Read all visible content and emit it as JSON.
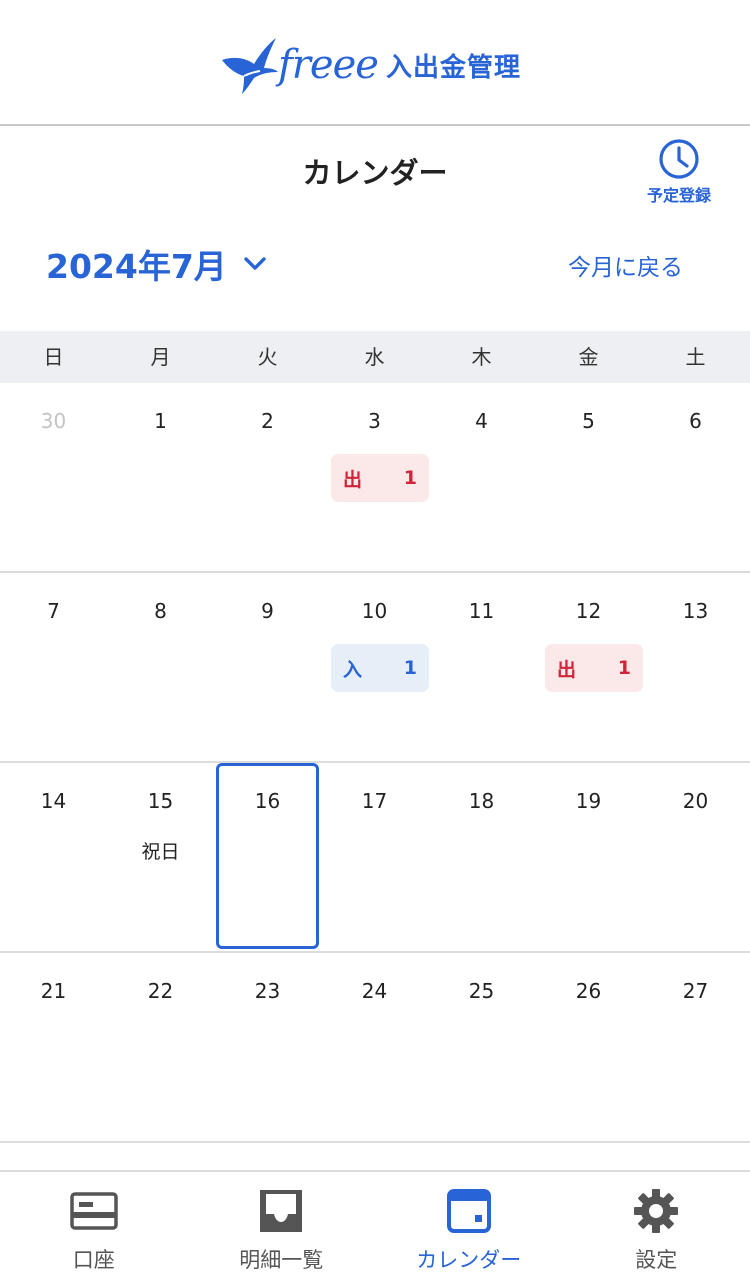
{
  "header": {
    "logo_word": "freee",
    "logo_product": "入出金管理",
    "title": "カレンダー",
    "schedule_button_label": "予定登録",
    "schedule_icon": "clock-icon"
  },
  "month": {
    "label": "2024年7月",
    "back_link": "今月に戻る"
  },
  "weekdays": [
    "日",
    "月",
    "火",
    "水",
    "木",
    "金",
    "土"
  ],
  "weeks": [
    {
      "days": [
        "30",
        "1",
        "2",
        "3",
        "4",
        "5",
        "6"
      ]
    },
    {
      "days": [
        "7",
        "8",
        "9",
        "10",
        "11",
        "12",
        "13"
      ]
    },
    {
      "days": [
        "14",
        "15",
        "16",
        "17",
        "18",
        "19",
        "20"
      ]
    },
    {
      "days": [
        "21",
        "22",
        "23",
        "24",
        "25",
        "26",
        "27"
      ]
    }
  ],
  "events": [
    {
      "date": "3",
      "type": "出",
      "count": "1",
      "kind": "withdrawal"
    },
    {
      "date": "10",
      "type": "入",
      "count": "1",
      "kind": "deposit"
    },
    {
      "date": "12",
      "type": "出",
      "count": "1",
      "kind": "withdrawal"
    }
  ],
  "holiday": {
    "date": "15",
    "label": "祝日"
  },
  "selected_date": "16",
  "tabs": [
    {
      "label": "口座",
      "icon": "bank-card-icon",
      "active": false
    },
    {
      "label": "明細一覧",
      "icon": "inbox-icon",
      "active": false
    },
    {
      "label": "カレンダー",
      "icon": "calendar-icon",
      "active": true
    },
    {
      "label": "設定",
      "icon": "gear-icon",
      "active": false
    }
  ],
  "colors": {
    "accent": "#2864d6",
    "withdrawal_text": "#d0243a",
    "withdrawal_bg": "#fbe9ea",
    "deposit_bg": "#e6eef8",
    "weekday_bar_bg": "#edeff2"
  }
}
